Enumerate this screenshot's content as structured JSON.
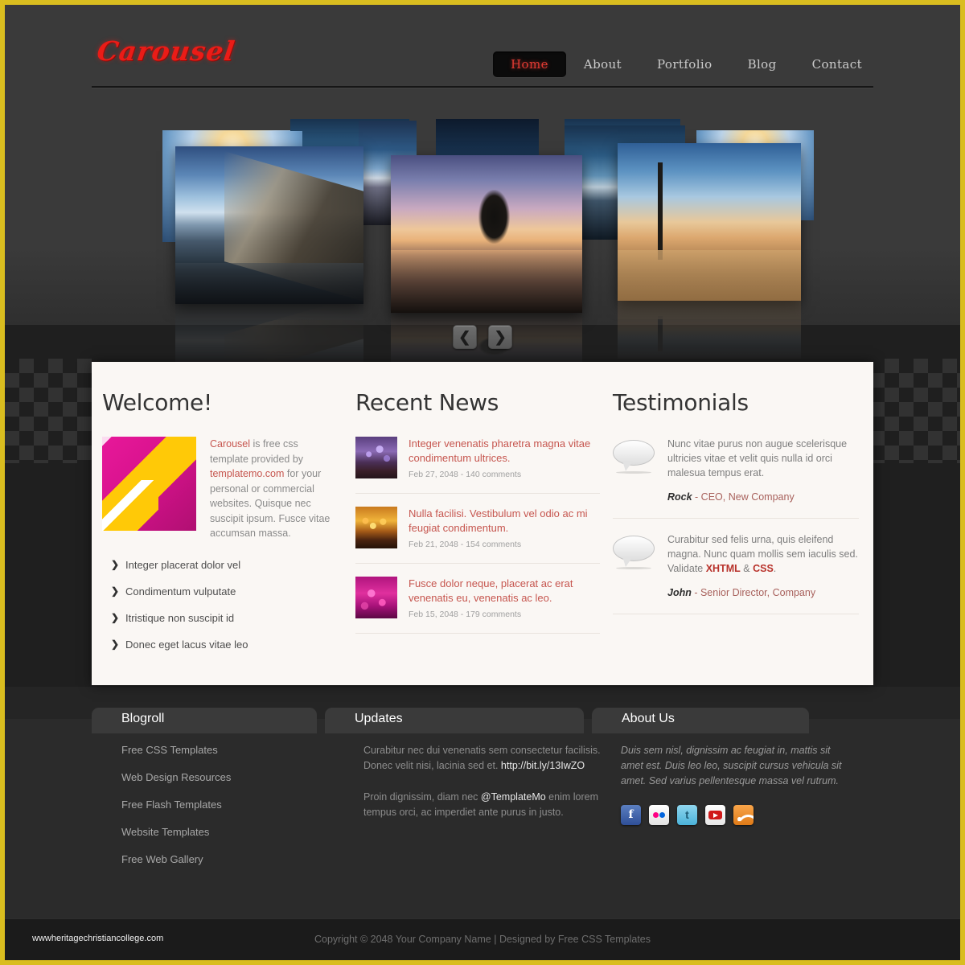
{
  "brand": {
    "logo": "Carousel",
    "accent": "#ea1c17"
  },
  "nav": {
    "items": [
      {
        "label": "Home",
        "active": true
      },
      {
        "label": "About",
        "active": false
      },
      {
        "label": "Portfolio",
        "active": false
      },
      {
        "label": "Blog",
        "active": false
      },
      {
        "label": "Contact",
        "active": false
      }
    ]
  },
  "carousel": {
    "prev_label": "❮",
    "next_label": "❯"
  },
  "welcome": {
    "heading": "Welcome!",
    "intro_lead": "Carousel",
    "intro_mid": " is free css template provided by ",
    "intro_link": "templatemo.com",
    "intro_tail": " for your personal or commercial websites. Quisque nec suscipit ipsum. Fusce vitae accumsan massa.",
    "list": [
      "Integer placerat dolor vel",
      "Condimentum vulputate",
      "Itristique non suscipit id",
      "Donec eget lacus vitae leo"
    ]
  },
  "news": {
    "heading": "Recent News",
    "items": [
      {
        "title": "Integer venenatis pharetra magna vitae condimentum  ultrices.",
        "meta": "Feb 27, 2048 - 140 comments"
      },
      {
        "title": "Nulla facilisi. Vestibulum vel odio ac mi feugiat condimentum.",
        "meta": "Feb 21, 2048 - 154 comments"
      },
      {
        "title": "Fusce dolor neque, placerat ac erat venenatis eu, venenatis ac leo.",
        "meta": "Feb 15, 2048 - 179 comments"
      }
    ]
  },
  "testimonials": {
    "heading": "Testimonials",
    "items": [
      {
        "text": "Nunc vitae purus non augue scelerisque ultricies vitae et velit quis nulla id orci malesua tempus erat.",
        "name": "Rock",
        "role": " - CEO, New Company"
      },
      {
        "text_a": "Curabitur sed felis urna, quis eleifend magna. Nunc quam mollis sem iaculis sed. Validate ",
        "link_a": "XHTML",
        "text_b": " & ",
        "link_b": "CSS",
        "text_c": ".",
        "name": "John",
        "role": " - Senior Director, Company"
      }
    ]
  },
  "footer": {
    "blogroll": {
      "title": "Blogroll",
      "links": [
        "Free CSS Templates",
        "Web Design Resources",
        "Free Flash Templates",
        "Website Templates",
        "Free Web Gallery"
      ]
    },
    "updates": {
      "title": "Updates",
      "p1_a": "Curabitur nec dui venenatis sem consectetur facilisis. Donec velit nisi, lacinia sed et. ",
      "p1_link": "http://bit.ly/13IwZO",
      "p2_a": "Proin dignissim, diam nec ",
      "p2_link": "@TemplateMo",
      "p2_b": " enim lorem tempus orci, ac imperdiet ante purus in justo."
    },
    "about": {
      "title": "About Us",
      "text": "Duis sem nisl, dignissim ac feugiat in, mattis sit amet est. Duis leo leo, suscipit cursus vehicula sit amet. Sed varius pellentesque massa vel rutrum.",
      "socials": [
        {
          "name": "facebook",
          "glyph": "f"
        },
        {
          "name": "flickr",
          "glyph": ""
        },
        {
          "name": "twitter",
          "glyph": "t"
        },
        {
          "name": "youtube",
          "glyph": ""
        },
        {
          "name": "rss",
          "glyph": ""
        }
      ]
    }
  },
  "bottom": {
    "site_url": "wwwheritagechristiancollege.com",
    "copyright": "Copyright © 2048 Your Company Name | Designed by Free CSS Templates"
  }
}
